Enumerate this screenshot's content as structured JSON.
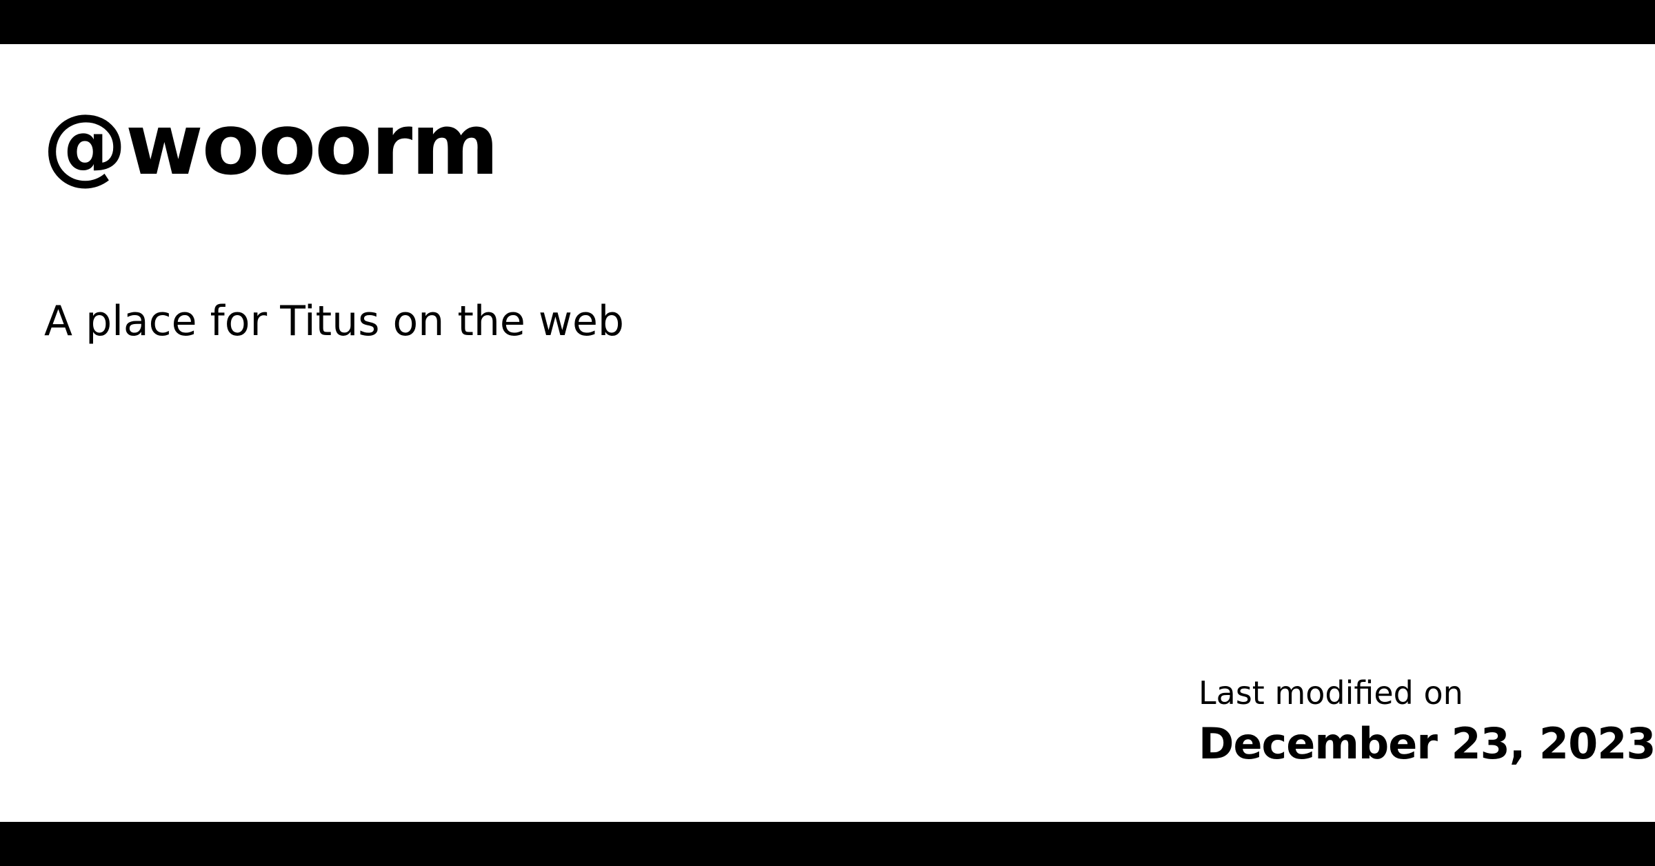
{
  "card": {
    "title": "@wooorm",
    "description": "A place for Titus on the web",
    "modified": {
      "label": "Last modified on",
      "date": "December 23, 2023"
    }
  },
  "colors": {
    "background": "#ffffff",
    "text": "#000000",
    "bars": "#000000"
  }
}
